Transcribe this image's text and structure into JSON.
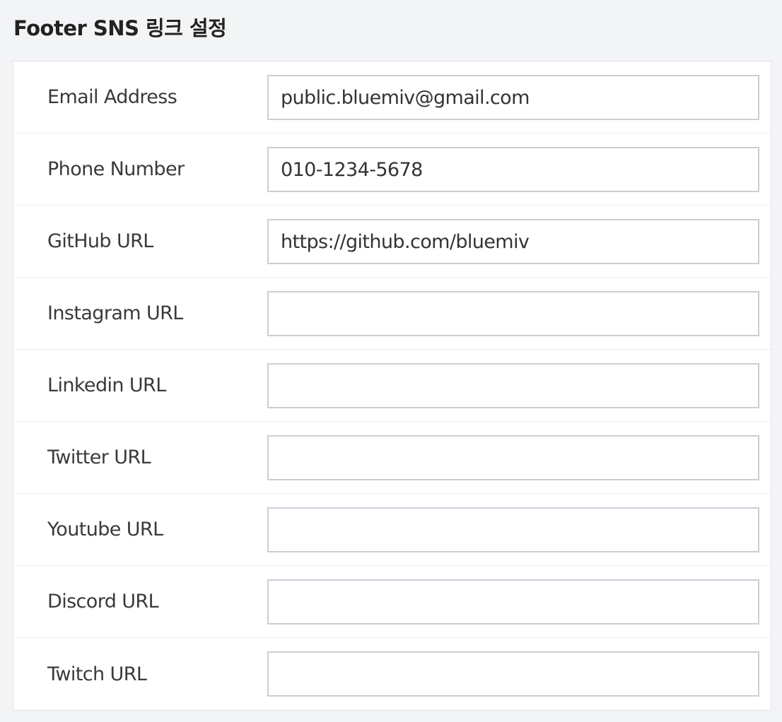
{
  "page": {
    "title": "Footer SNS 링크 설정"
  },
  "rows": [
    {
      "label": "Email Address",
      "value": "public.bluemiv@gmail.com"
    },
    {
      "label": "Phone Number",
      "value": "010-1234-5678"
    },
    {
      "label": "GitHub URL",
      "value": "https://github.com/bluemiv"
    },
    {
      "label": "Instagram URL",
      "value": ""
    },
    {
      "label": "Linkedin URL",
      "value": ""
    },
    {
      "label": "Twitter URL",
      "value": ""
    },
    {
      "label": "Youtube URL",
      "value": ""
    },
    {
      "label": "Discord URL",
      "value": ""
    },
    {
      "label": "Twitch URL",
      "value": ""
    }
  ]
}
